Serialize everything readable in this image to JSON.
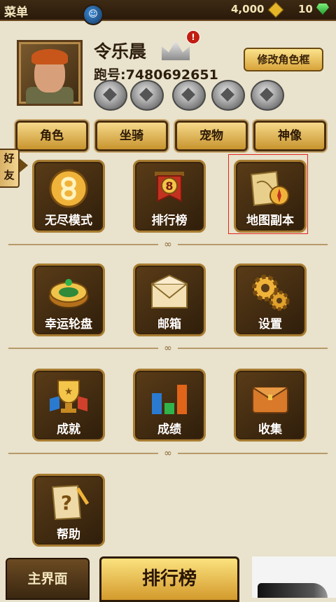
{
  "header": {
    "title": "菜单",
    "coins": "4,000",
    "gems": "10"
  },
  "profile": {
    "name": "令乐晨",
    "id_label": "跑号:7480692651",
    "crown_badge": "!",
    "edit_button": "修改角色框"
  },
  "tabs": [
    "角色",
    "坐骑",
    "宠物",
    "神像"
  ],
  "friends_tab": "好友",
  "tiles": [
    {
      "label": "无尽模式",
      "icon": "endless-mode-icon"
    },
    {
      "label": "排行榜",
      "icon": "leaderboard-banner-icon"
    },
    {
      "label": "地图副本",
      "icon": "map-compass-icon"
    },
    {
      "label": "幸运轮盘",
      "icon": "lucky-wheel-icon"
    },
    {
      "label": "邮箱",
      "icon": "mail-envelope-icon"
    },
    {
      "label": "设置",
      "icon": "gears-icon"
    },
    {
      "label": "成就",
      "icon": "trophy-icon"
    },
    {
      "label": "成绩",
      "icon": "bar-chart-icon"
    },
    {
      "label": "收集",
      "icon": "wallet-icon"
    },
    {
      "label": "帮助",
      "icon": "help-scroll-icon"
    }
  ],
  "bottom": {
    "main_label": "主界面",
    "rank_label": "排行榜"
  },
  "colors": {
    "accent_gold": "#d8a33a",
    "highlight": "#e2241b",
    "background": "#e9e2cc"
  }
}
